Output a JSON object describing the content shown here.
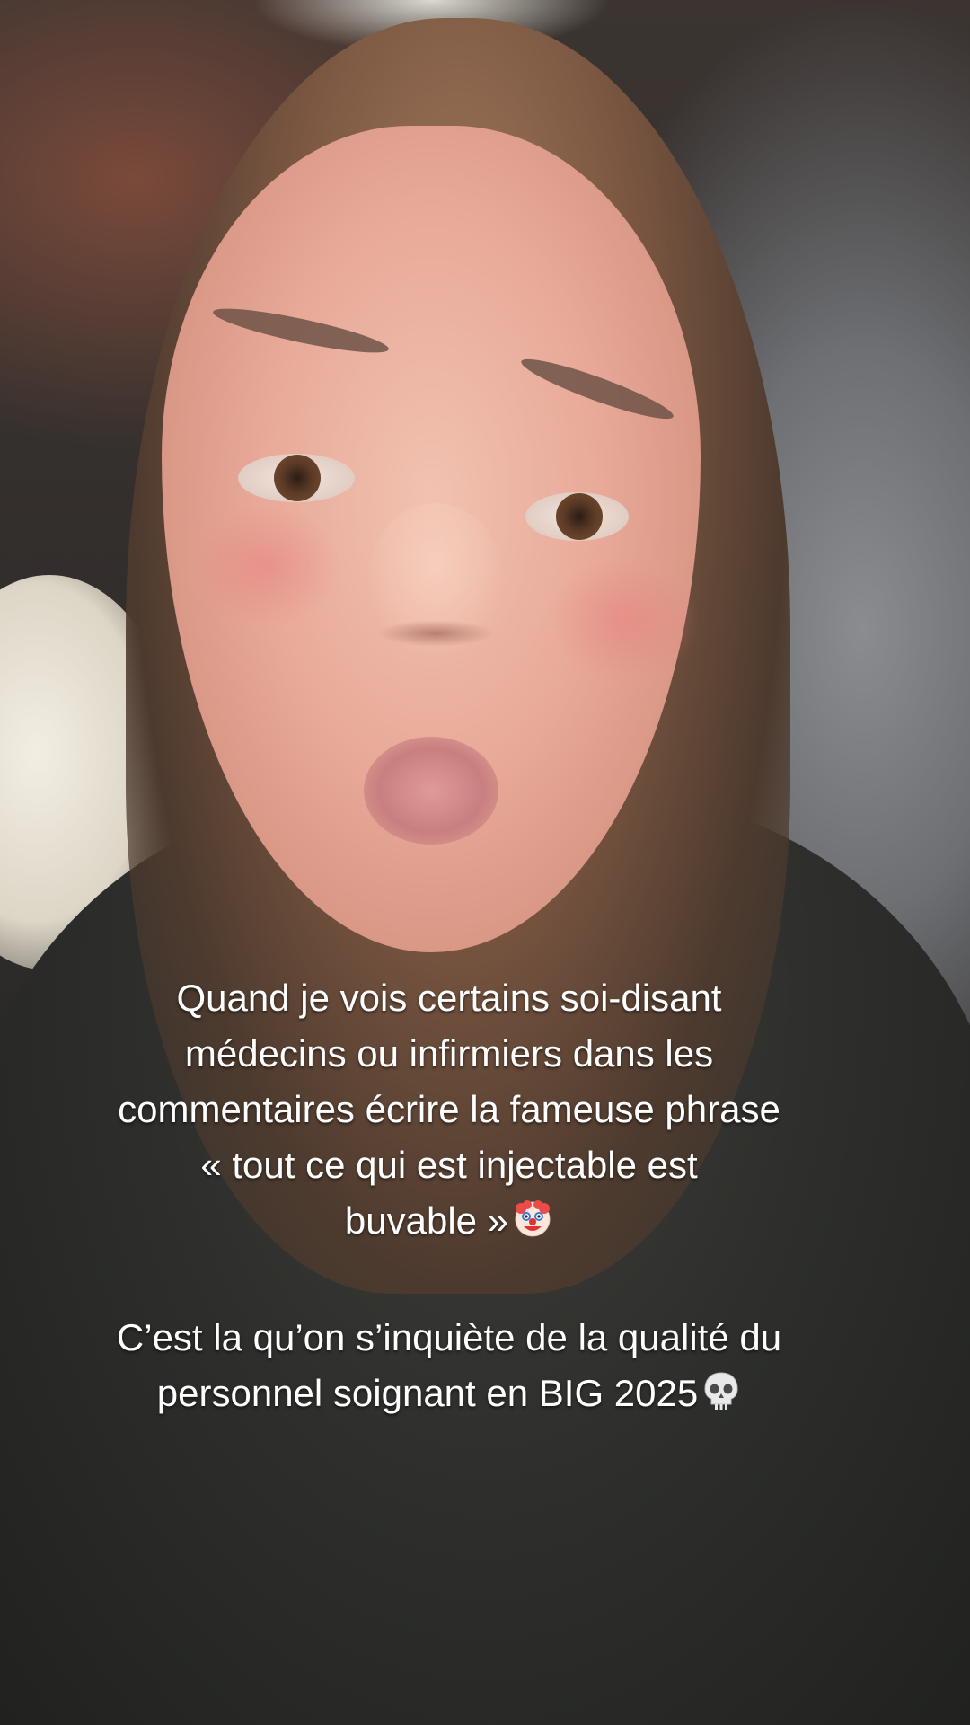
{
  "caption": {
    "lines": [
      "Quand je vois certains soi-disant",
      "médecins ou infirmiers dans les",
      "commentaires écrire la fameuse phrase",
      "« tout ce qui est injectable est",
      "buvable »"
    ],
    "second_block": [
      "C’est la qu’on s’inquiète de la qualité du",
      "personnel soignant en BIG 2025"
    ],
    "emoji_1": "clown-face",
    "emoji_2": "skull"
  }
}
